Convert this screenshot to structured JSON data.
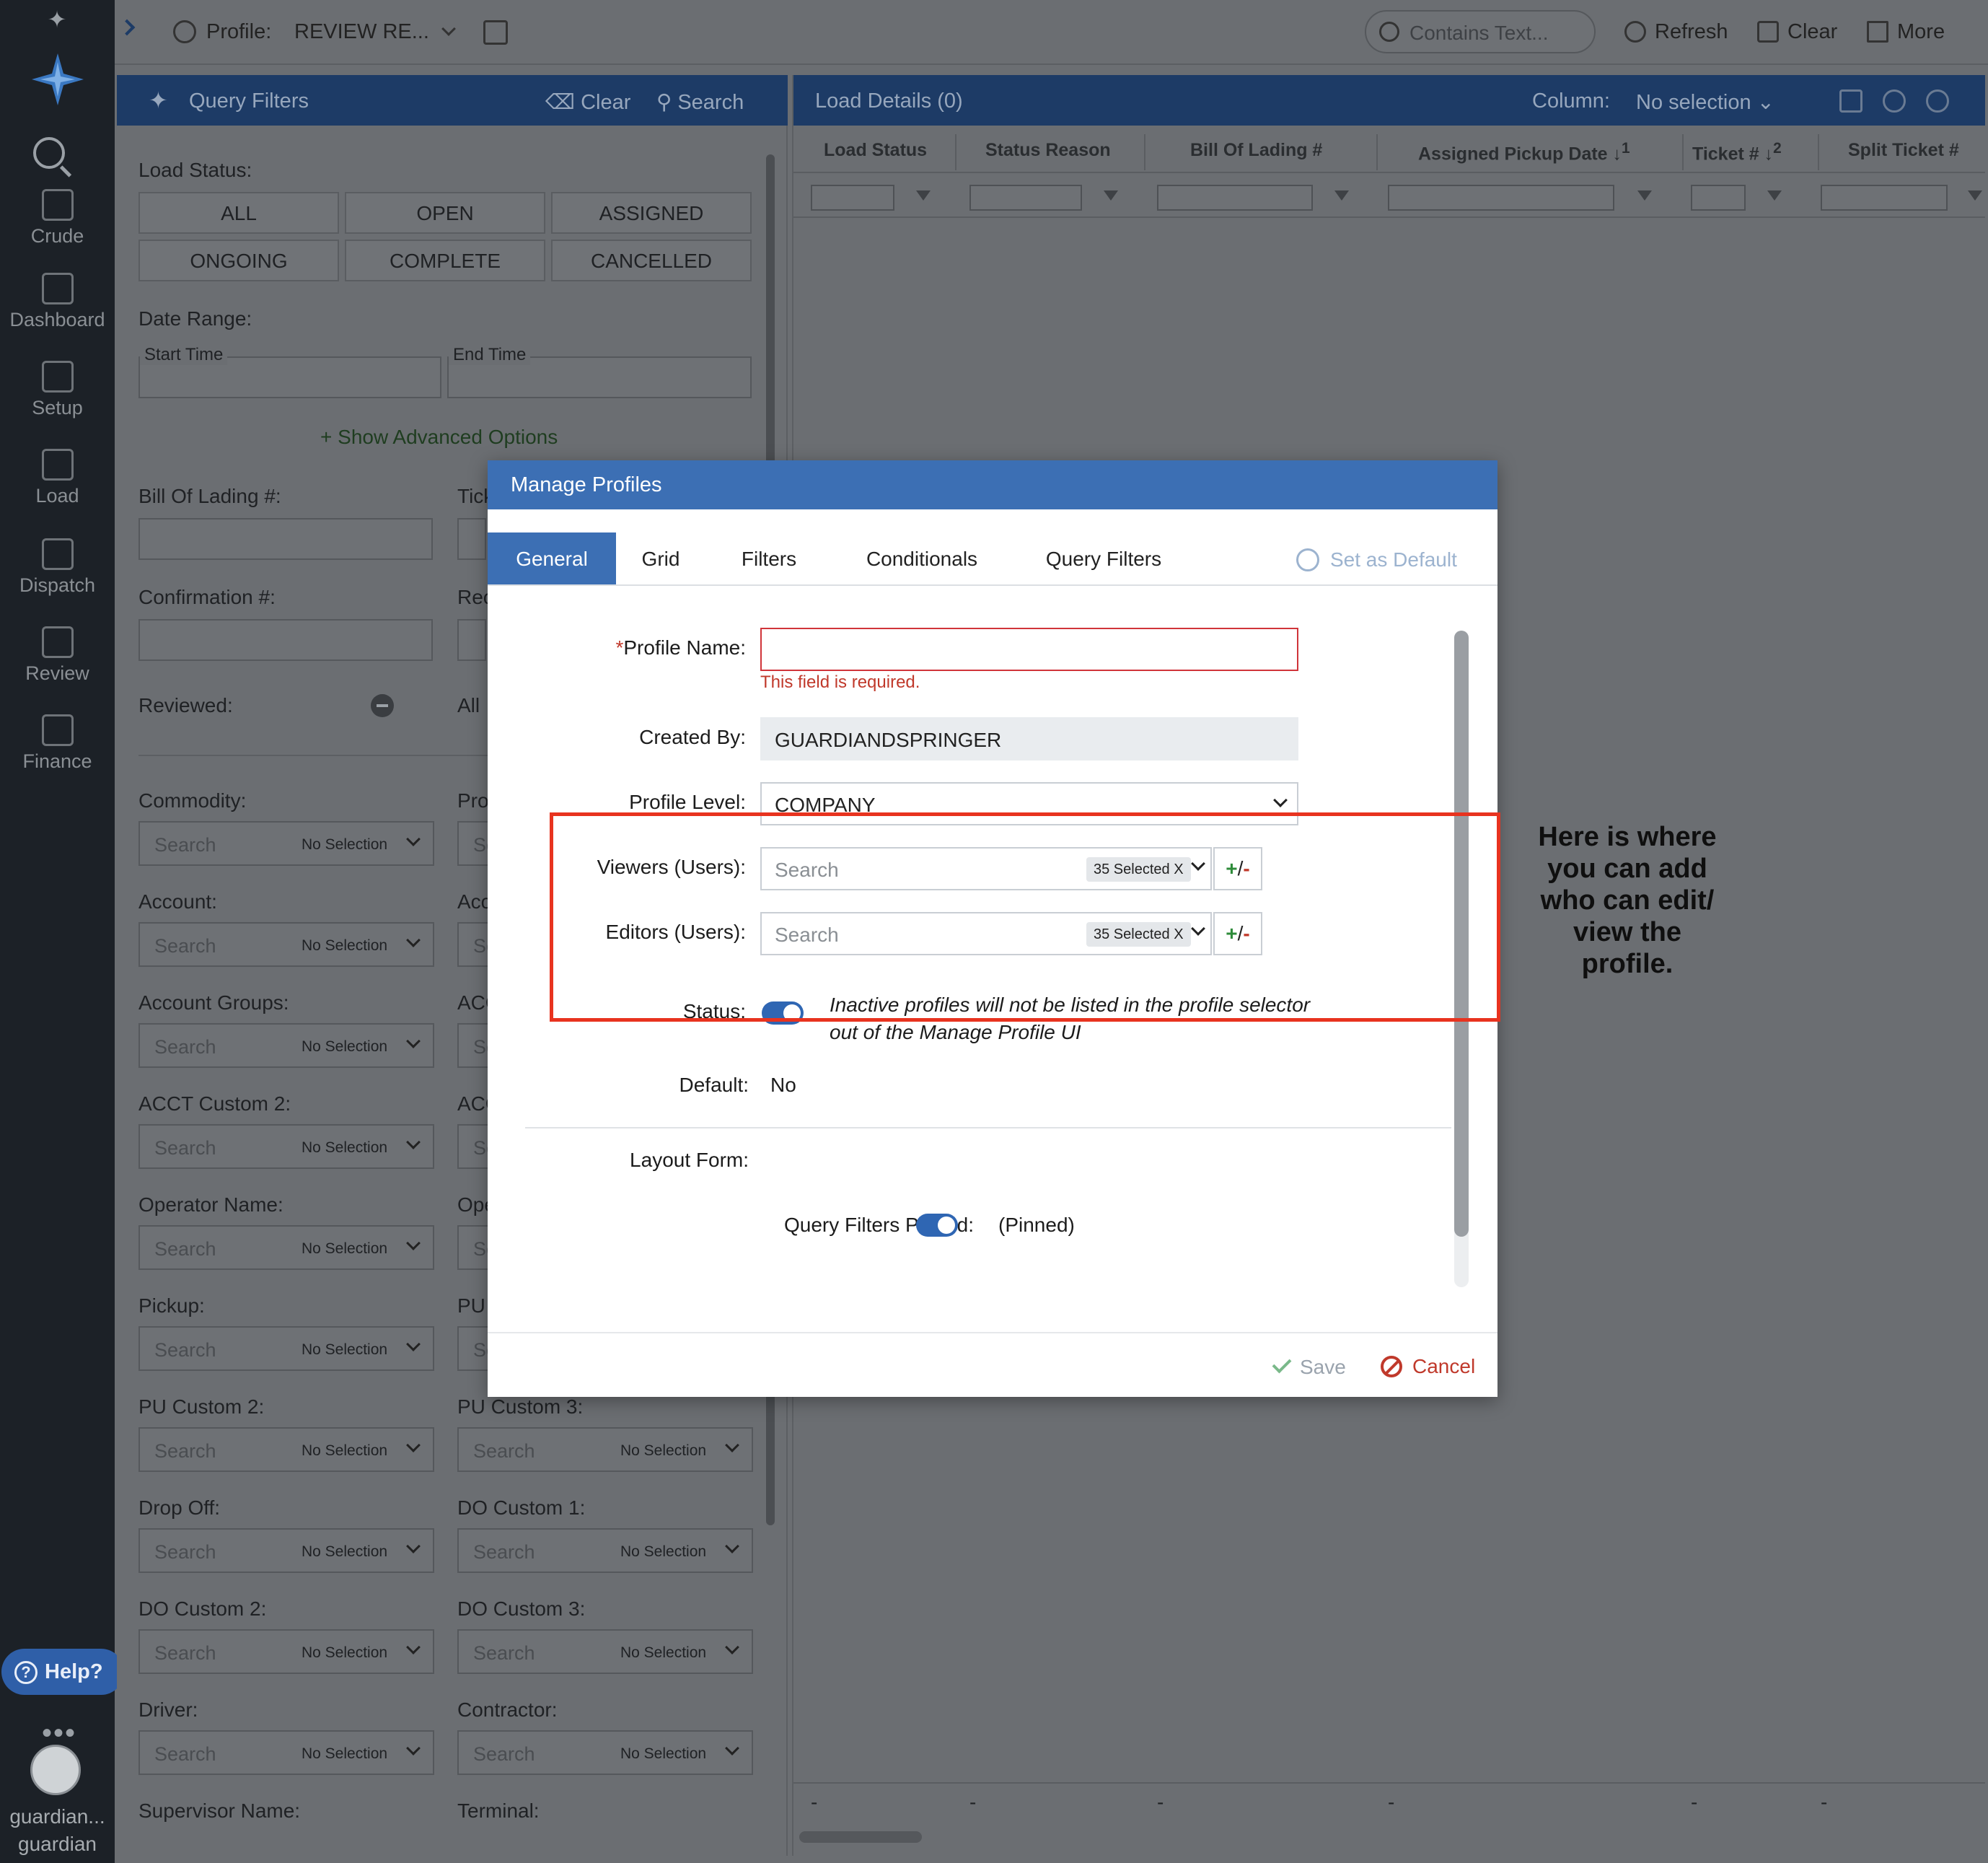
{
  "rail": {
    "items": [
      {
        "label": "Crude",
        "icon": "crude-icon"
      },
      {
        "label": "Dashboard",
        "icon": "dashboard-icon"
      },
      {
        "label": "Setup",
        "icon": "setup-icon"
      },
      {
        "label": "Load",
        "icon": "load-icon"
      },
      {
        "label": "Dispatch",
        "icon": "dispatch-icon"
      },
      {
        "label": "Review",
        "icon": "review-icon"
      },
      {
        "label": "Finance",
        "icon": "finance-icon"
      }
    ],
    "help_label": "Help?",
    "user_line1": "guardian...",
    "user_line2": "guardian"
  },
  "topbar": {
    "profile_label": "Profile:",
    "profile_value": "REVIEW RE...",
    "search_placeholder": "Contains Text...",
    "refresh_label": "Refresh",
    "clear_label": "Clear",
    "more_label": "More"
  },
  "query_filters": {
    "title": "Query Filters",
    "clear_label": "Clear",
    "search_label": "Search",
    "load_status_label": "Load Status:",
    "statuses": [
      "ALL",
      "OPEN",
      "ASSIGNED",
      "ONGOING",
      "COMPLETE",
      "CANCELLED"
    ],
    "date_range_label": "Date Range:",
    "start_time_label": "Start Time",
    "end_time_label": "End Time",
    "advanced_label": "Show Advanced Options",
    "bol_label": "Bill Of Lading #:",
    "ticket_label": "Tick",
    "confirmation_label": "Confirmation #:",
    "rec_label": "Rec",
    "reviewed_label": "Reviewed:",
    "reviewed_value": "All",
    "search_placeholder": "Search",
    "no_selection": "No Selection",
    "left_fields": [
      "Commodity:",
      "Account:",
      "Account Groups:",
      "ACCT Custom 2:",
      "Operator Name:",
      "Pickup:",
      "PU Custom 2:",
      "Drop Off:",
      "DO Custom 2:",
      "Driver:"
    ],
    "right_fields": [
      "Pro",
      "Acc",
      "ACC",
      "ACC",
      "Ope",
      "PU",
      "PU Custom 3:",
      "DO Custom 1:",
      "DO Custom 3:",
      "Contractor:"
    ],
    "right_partial_ph": "Se",
    "bottom_left": "Supervisor Name:",
    "bottom_right": "Terminal:"
  },
  "load_details": {
    "title": "Load Details (0)",
    "column_label": "Column:",
    "column_value": "No selection",
    "columns": [
      "Load Status",
      "Status Reason",
      "Bill Of Lading #",
      "Assigned Pickup Date ↓",
      "Ticket # ↓",
      "Split Ticket #"
    ],
    "sort_marks": [
      "1",
      "2"
    ],
    "empty_dash": "-"
  },
  "modal": {
    "title": "Manage Profiles",
    "tabs": [
      "General",
      "Grid",
      "Filters",
      "Conditionals",
      "Query Filters"
    ],
    "set_default_label": "Set as Default",
    "profile_name_label": "Profile Name:",
    "required_star": "*",
    "profile_name_value": "",
    "error_text": "This field is required.",
    "created_by_label": "Created By:",
    "created_by_value": "GUARDIANDSPRINGER",
    "profile_level_label": "Profile Level:",
    "profile_level_value": "COMPANY",
    "viewers_label": "Viewers (Users):",
    "editors_label": "Editors (Users):",
    "search_placeholder": "Search",
    "selected_badge": "35 Selected X",
    "plus": "+",
    "slash": "/",
    "minus": "-",
    "status_label": "Status:",
    "status_note": "Inactive profiles will not be listed in the profile selector out of the Manage Profile UI",
    "default_label": "Default:",
    "default_value": "No",
    "layout_form_label": "Layout Form:",
    "qf_pinned_label": "Query Filters Pinned:",
    "qf_pinned_value": "(Pinned)",
    "save_label": "Save",
    "cancel_label": "Cancel"
  },
  "annotation": {
    "callout": "Here is where you can add who can edit/ view the profile.",
    "box_color": "#e8331f"
  }
}
